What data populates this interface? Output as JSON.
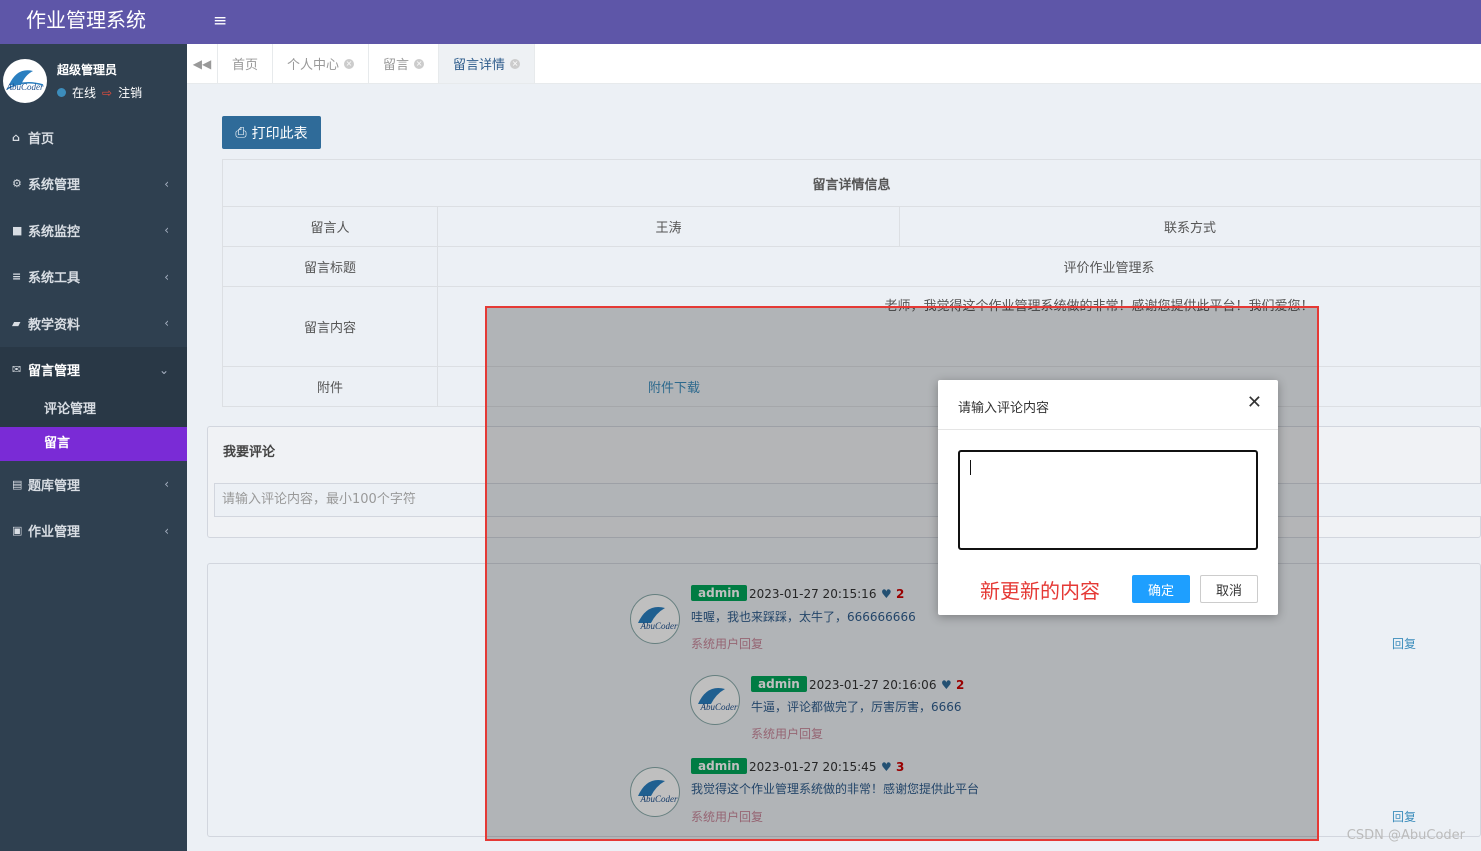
{
  "app": {
    "title": "作业管理系统"
  },
  "user": {
    "name": "超级管理员",
    "status": "在线",
    "logout": "注销"
  },
  "sidebar": {
    "items": [
      {
        "label": "首页",
        "icon": "home-icon"
      },
      {
        "label": "系统管理",
        "icon": "gear-icon"
      },
      {
        "label": "系统监控",
        "icon": "video-camera-icon"
      },
      {
        "label": "系统工具",
        "icon": "bars-icon"
      },
      {
        "label": "教学资料",
        "icon": "folder-open-icon"
      },
      {
        "label": "留言管理",
        "icon": "envelope-open-icon"
      },
      {
        "label": "题库管理",
        "icon": "book-icon"
      },
      {
        "label": "作业管理",
        "icon": "id-card-icon"
      }
    ],
    "submenu": [
      {
        "label": "评论管理"
      },
      {
        "label": "留言"
      }
    ]
  },
  "tabs": [
    {
      "label": "首页"
    },
    {
      "label": "个人中心"
    },
    {
      "label": "留言"
    },
    {
      "label": "留言详情"
    }
  ],
  "toolbar": {
    "print_label": "打印此表"
  },
  "detail": {
    "title": "留言详情信息",
    "author_label": "留言人",
    "author_value": "王涛",
    "contact_label": "联系方式",
    "subject_label": "留言标题",
    "subject_value": "评价作业管理系",
    "content_label": "留言内容",
    "content_value": "老师，我觉得这个作业管理系统做的非常！感谢您提供此平台！我们爱您！",
    "attachment_label": "附件",
    "attachment_link": "附件下载"
  },
  "comment_form": {
    "title": "我要评论",
    "placeholder": "请输入评论内容，最小100个字符"
  },
  "comments": [
    {
      "user": "admin",
      "time": "2023-01-27 20:15:16",
      "likes": "2",
      "text": "哇喔，我也来踩踩，太牛了，666666666",
      "note": "系统用户回复",
      "reply": "回复"
    },
    {
      "user": "admin",
      "time": "2023-01-27 20:16:06",
      "likes": "2",
      "text": "牛逼，评论都做完了，厉害厉害，6666",
      "note": "系统用户回复"
    },
    {
      "user": "admin",
      "time": "2023-01-27 20:15:45",
      "likes": "3",
      "text": "我觉得这个作业管理系统做的非常！感谢您提供此平台",
      "note": "系统用户回复",
      "reply": "回复"
    }
  ],
  "avatar_text": "AbuCoder",
  "modal": {
    "title": "请输入评论内容",
    "annotation": "新更新的内容",
    "ok": "确定",
    "cancel": "取消"
  },
  "watermark": "CSDN @AbuCoder",
  "colors": {
    "brand": "#5e56a8",
    "sidebar": "#2f4050",
    "active": "#7a2bd6",
    "primary": "#1e9fff",
    "highlight": "#e53935"
  }
}
